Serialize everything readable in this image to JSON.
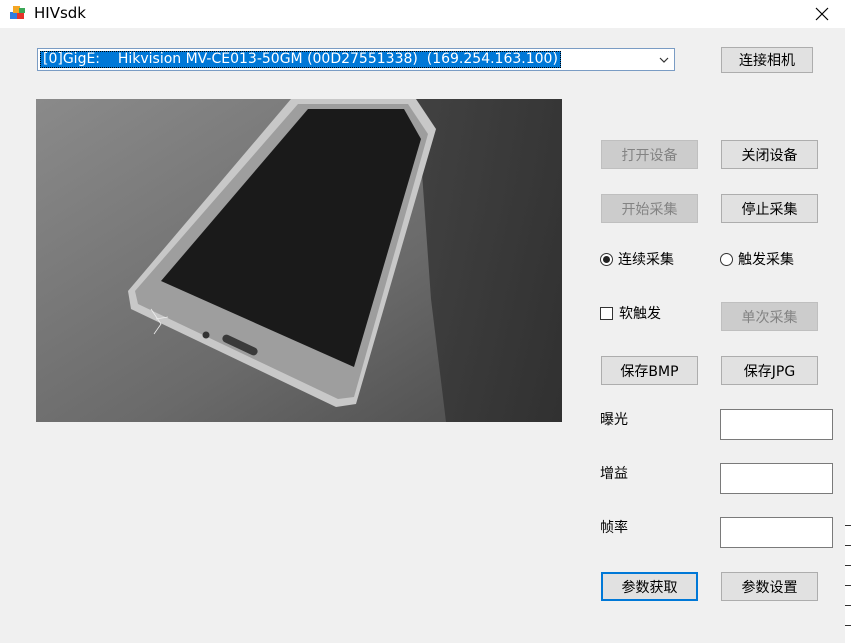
{
  "window": {
    "title": "HIVsdk",
    "close_glyph": "✕",
    "icon": "app-cubes-icon"
  },
  "device_select": {
    "selected": "[0]GigE:    Hikvision MV-CE013-50GM (00D27551338)  (169.254.163.100)"
  },
  "buttons": {
    "connect": "连接相机",
    "open": "打开设备",
    "close": "关闭设备",
    "start_grab": "开始采集",
    "stop_grab": "停止采集",
    "single_grab": "单次采集",
    "save_bmp": "保存BMP",
    "save_jpg": "保存JPG",
    "get_params": "参数获取",
    "set_params": "参数设置"
  },
  "modes": {
    "continuous": "连续采集",
    "trigger": "触发采集",
    "selected": "continuous"
  },
  "soft_trigger": {
    "label": "软触发",
    "checked": false
  },
  "params": {
    "exposure_label": "曝光",
    "gain_label": "增益",
    "framerate_label": "帧率",
    "exposure_value": "",
    "gain_value": "",
    "framerate_value": ""
  },
  "colors": {
    "selection": "#0078d7",
    "disabled_text": "#838383"
  }
}
